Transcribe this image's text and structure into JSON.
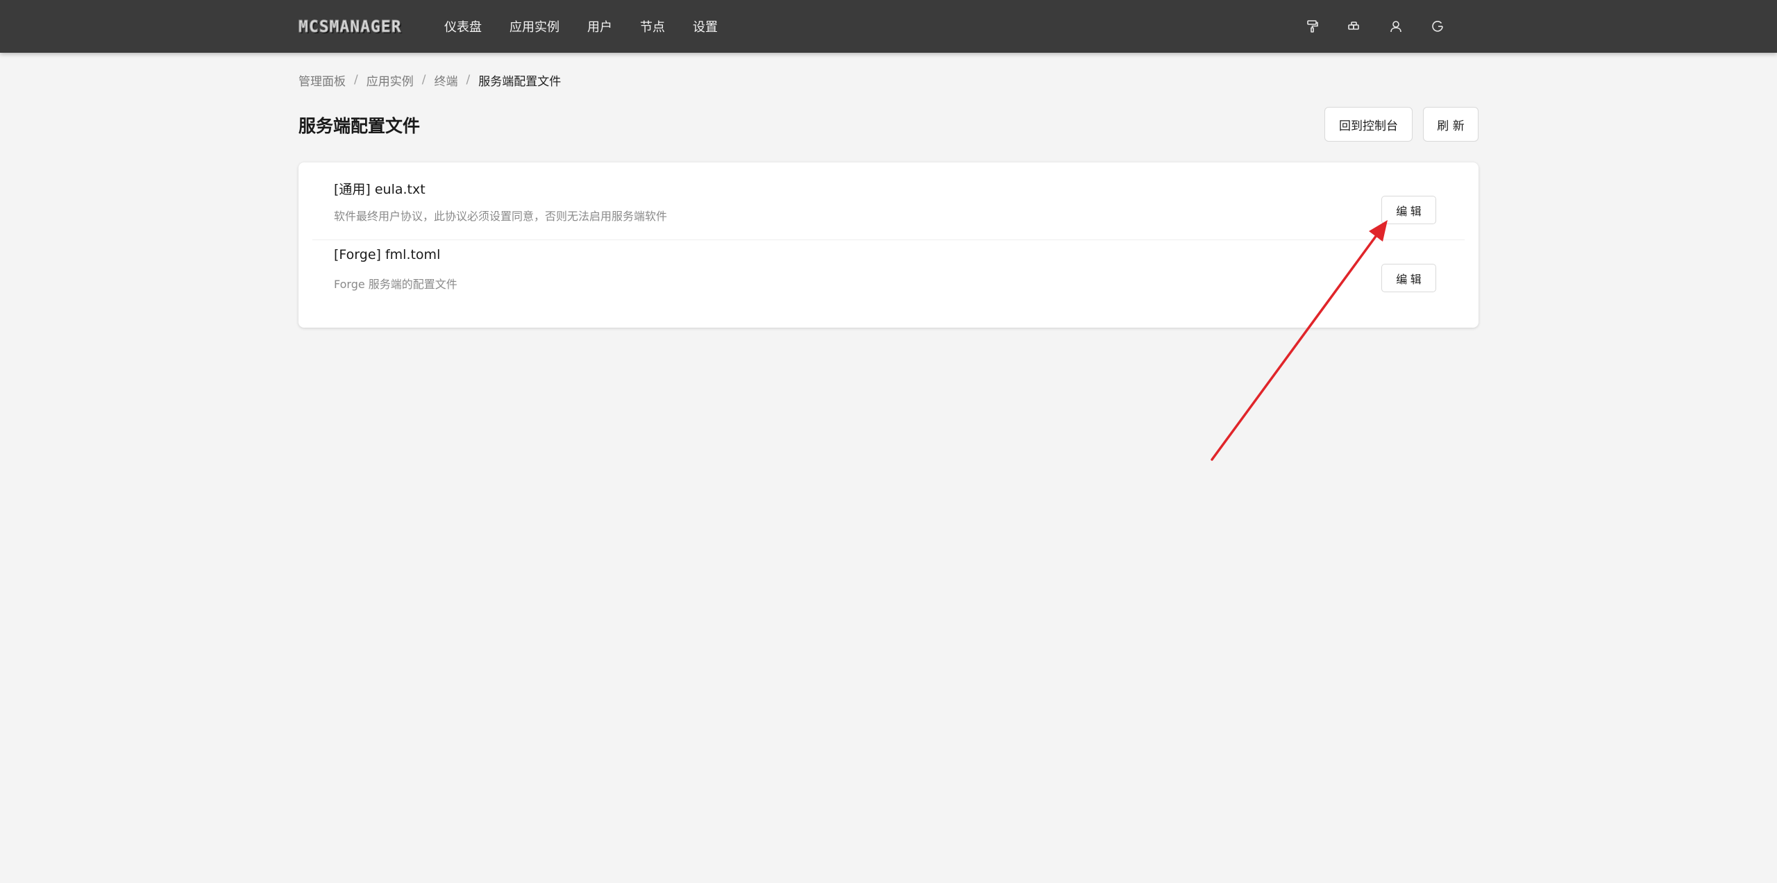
{
  "header": {
    "logo_text": "MCSMANAGER",
    "nav": [
      {
        "label": "仪表盘"
      },
      {
        "label": "应用实例"
      },
      {
        "label": "用户"
      },
      {
        "label": "节点"
      },
      {
        "label": "设置"
      }
    ],
    "icons": [
      "paint-roller-icon",
      "layout-icon",
      "user-icon",
      "logout-icon"
    ]
  },
  "breadcrumb": {
    "items": [
      "管理面板",
      "应用实例",
      "终端"
    ],
    "current": "服务端配置文件",
    "separator": "/"
  },
  "page": {
    "title": "服务端配置文件",
    "back_console_label": "回到控制台",
    "refresh_label": "刷 新"
  },
  "config_files": [
    {
      "title": "[通用] eula.txt",
      "description": "软件最终用户协议，此协议必须设置同意，否则无法启用服务端软件",
      "edit_label": "编 辑"
    },
    {
      "title": "[Forge] fml.toml",
      "description": "Forge 服务端的配置文件",
      "edit_label": "编 辑"
    }
  ],
  "colors": {
    "topbar": "#3b3b3b",
    "background": "#f4f4f4",
    "annotation_arrow": "#e0252a"
  }
}
